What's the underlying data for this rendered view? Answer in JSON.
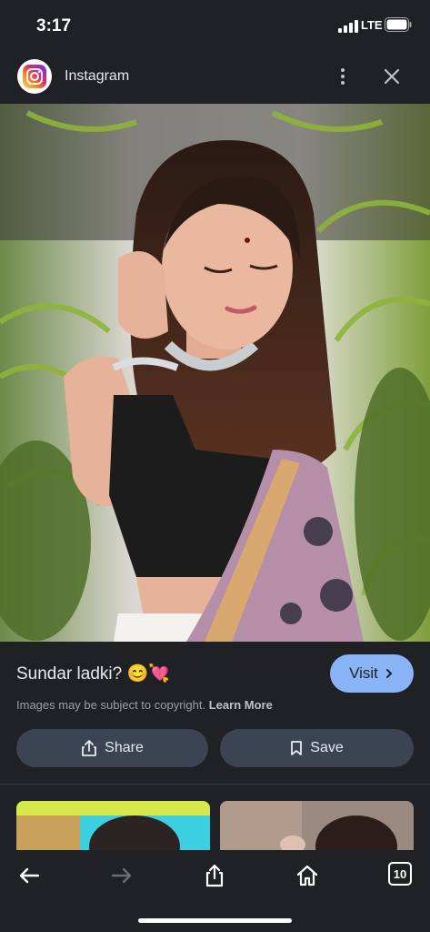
{
  "status_bar": {
    "time": "3:17",
    "network": "LTE"
  },
  "source": {
    "name": "Instagram",
    "logo_icon": "instagram-icon"
  },
  "image": {
    "description_icon": "photo"
  },
  "result": {
    "title": "Sundar ladki? 😊💘",
    "visit_label": "Visit",
    "copyright_text": "Images may be subject to copyright.",
    "learn_more": "Learn More"
  },
  "actions": {
    "share_label": "Share",
    "save_label": "Save"
  },
  "toolbar": {
    "tabs_count": "10"
  },
  "colors": {
    "background": "#202124",
    "accent": "#8ab4f8",
    "button": "#3c4454"
  }
}
